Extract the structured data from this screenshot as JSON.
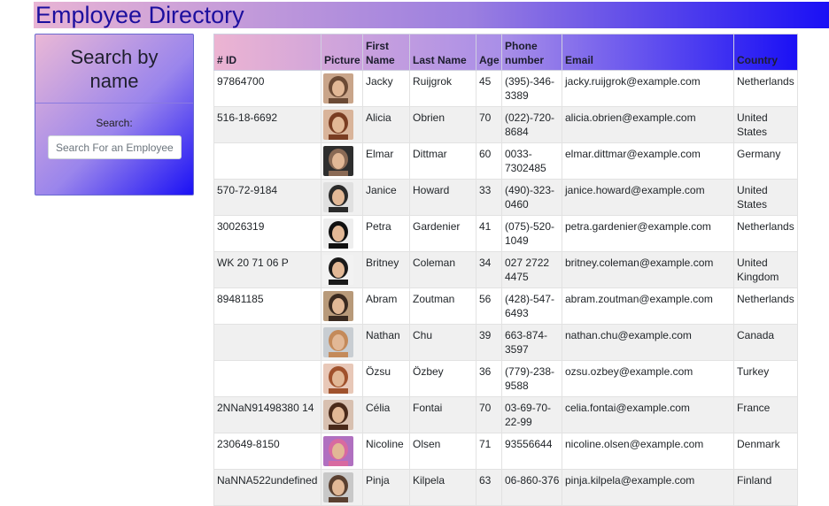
{
  "header": {
    "title": "Employee Directory"
  },
  "sidebar": {
    "title": "Search by name",
    "search_label": "Search:",
    "search_placeholder": "Search For an Employee"
  },
  "table": {
    "columns": [
      "# ID",
      "Picture",
      "First Name",
      "Last Name",
      "Age",
      "Phone number",
      "Email",
      "Country"
    ],
    "rows": [
      {
        "id": "97864700",
        "first": "Jacky",
        "last": "Ruijgrok",
        "age": "45",
        "phone": "(395)-346-3389",
        "email": "jacky.ruijgrok@example.com",
        "country": "Netherlands",
        "avatar_colors": [
          "#c9a58a",
          "#6b4a35"
        ]
      },
      {
        "id": "516-18-6692",
        "first": "Alicia",
        "last": "Obrien",
        "age": "70",
        "phone": "(022)-720-8684",
        "email": "alicia.obrien@example.com",
        "country": "United States",
        "avatar_colors": [
          "#d9b49a",
          "#7a3d22"
        ]
      },
      {
        "id": "",
        "first": "Elmar",
        "last": "Dittmar",
        "age": "60",
        "phone": "0033-7302485",
        "email": "elmar.dittmar@example.com",
        "country": "Germany",
        "avatar_colors": [
          "#2e2e2e",
          "#8a6a55"
        ]
      },
      {
        "id": "570-72-9184",
        "first": "Janice",
        "last": "Howard",
        "age": "33",
        "phone": "(490)-323-0460",
        "email": "janice.howard@example.com",
        "country": "United States",
        "avatar_colors": [
          "#e0e0e0",
          "#2a2a2a"
        ]
      },
      {
        "id": "30026319",
        "first": "Petra",
        "last": "Gardenier",
        "age": "41",
        "phone": "(075)-520-1049",
        "email": "petra.gardenier@example.com",
        "country": "Netherlands",
        "avatar_colors": [
          "#eeeeee",
          "#111111"
        ]
      },
      {
        "id": "WK 20 71 06 P",
        "first": "Britney",
        "last": "Coleman",
        "age": "34",
        "phone": "027 2722 4475",
        "email": "britney.coleman@example.com",
        "country": "United Kingdom",
        "avatar_colors": [
          "#f2f2f2",
          "#1a1a1a"
        ]
      },
      {
        "id": "89481185",
        "first": "Abram",
        "last": "Zoutman",
        "age": "56",
        "phone": "(428)-547-6493",
        "email": "abram.zoutman@example.com",
        "country": "Netherlands",
        "avatar_colors": [
          "#b89a7a",
          "#3a2a20"
        ]
      },
      {
        "id": "",
        "first": "Nathan",
        "last": "Chu",
        "age": "39",
        "phone": "663-874-3597",
        "email": "nathan.chu@example.com",
        "country": "Canada",
        "avatar_colors": [
          "#c8cdd2",
          "#c48a5a"
        ]
      },
      {
        "id": "",
        "first": "Özsu",
        "last": "Özbey",
        "age": "36",
        "phone": "(779)-238-9588",
        "email": "ozsu.ozbey@example.com",
        "country": "Turkey",
        "avatar_colors": [
          "#e8c8b8",
          "#a0522d"
        ]
      },
      {
        "id": "2NNaN91498380 14",
        "first": "Célia",
        "last": "Fontai",
        "age": "70",
        "phone": "03-69-70-22-99",
        "email": "celia.fontai@example.com",
        "country": "France",
        "avatar_colors": [
          "#d8c0b0",
          "#4a2a1a"
        ]
      },
      {
        "id": "230649-8150",
        "first": "Nicoline",
        "last": "Olsen",
        "age": "71",
        "phone": "93556644",
        "email": "nicoline.olsen@example.com",
        "country": "Denmark",
        "avatar_colors": [
          "#b070c0",
          "#d86aa0"
        ]
      },
      {
        "id": "NaNNA522undefined",
        "first": "Pinja",
        "last": "Kilpela",
        "age": "63",
        "phone": "06-860-376",
        "email": "pinja.kilpela@example.com",
        "country": "Finland",
        "avatar_colors": [
          "#c8c8c8",
          "#5a4030"
        ]
      }
    ]
  }
}
